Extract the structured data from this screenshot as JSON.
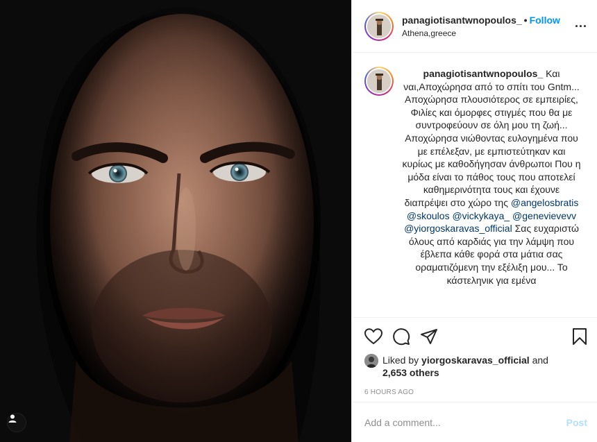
{
  "header": {
    "username": "panagiotisantwnopoulos_",
    "separator": "•",
    "follow_label": "Follow",
    "location": "Athena,greece",
    "more_label": "..."
  },
  "caption": {
    "username": "panagiotisantwnopoulos_",
    "text_1": " Και ναι,Αποχώρησα από το σπίτι του Gntm... Αποχώρησα πλουσιότερος σε εμπειρίες, Φιλίες και όμορφες στιγμές που θα με συντροφεύουν σε όλη μου τη ζωή... Αποχώρησα νιώθοντας ευλογημένα που με επέλεξαν, με εμπιστεύτηκαν και κυρίως με καθοδήγησαν άνθρωποι Που η μόδα είναι το πάθος τους που αποτελεί καθημερινότητα τους και έχουνε διαπρέψει στο χώρο της ",
    "mention_1": "@angelosbratis",
    "mention_2": "@skoulos",
    "mention_3": "@vickykaya_",
    "mention_4": "@genevievevv",
    "mention_5": "@yiorgoskaravas_official",
    "text_2": " Σας ευχαριστώ όλους από καρδιάς για την λάμψη που έβλεπα κάθε φορά στα μάτια σας οραματιζόμενη την εξέλιξη μου... Το κάστεληνικ για εμένα"
  },
  "likes": {
    "prefix": "Liked by ",
    "liker": "yiorgoskaravas_official",
    "and": " and",
    "count": "2,653 others"
  },
  "timestamp": "6 HOURS AGO",
  "comment": {
    "placeholder": "Add a comment...",
    "post_label": "Post"
  },
  "colors": {
    "link_blue": "#0095f6",
    "mention_blue": "#00376b",
    "post_disabled": "#b2dffc",
    "muted": "#8e8e8e"
  },
  "icons": [
    "heart-icon",
    "comment-icon",
    "share-icon",
    "bookmark-icon",
    "user-tag-icon"
  ]
}
